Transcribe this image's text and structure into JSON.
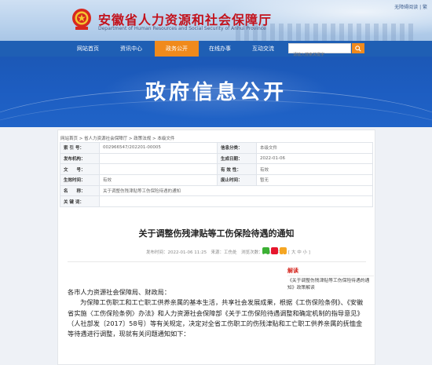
{
  "header": {
    "site_name": "安徽省人力资源和社会保障厅",
    "site_name_en": "Department of Human Resources and Social Security of Anhui Province",
    "top_links": "无障碍阅读 | 繁"
  },
  "nav": {
    "items": [
      "网站首页",
      "资讯中心",
      "政务公开",
      "在线办事",
      "互动交流"
    ],
    "active": "政务公开",
    "search_placeholder": "请输入搜索关键字"
  },
  "banner": {
    "title": "政府信息公开"
  },
  "breadcrumb": "网站首页 > 省人力资源社会保障厅 > 政策法规 > 本级文件",
  "meta": {
    "index_label": "索 引 号：",
    "index_value": "002966547/202201-00005",
    "category_label": "信息分类：",
    "category_value": "本级文件",
    "issuer_label": "发布机构：",
    "issuer_value": "",
    "date_label": "生成日期：",
    "date_value": "2022-01-06",
    "docno_label": "文　　号：",
    "docno_value": "",
    "validity_label": "有 效 性：",
    "validity_value": "有效",
    "effective_label": "生效时间：",
    "effective_value": "有效",
    "abolish_label": "废止时间：",
    "abolish_value": "暂无",
    "name_label": "名　　称：",
    "name_value": "关于调整伤残津贴等工伤保险待遇的通知",
    "keyword_label": "关 键 词：",
    "keyword_value": ""
  },
  "document": {
    "title": "关于调整伤残津贴等工伤保险待遇的通知",
    "info": "发布时间：2022-01-06 11:25　来源：工伤处　浏览次数：171　字体：[ 大 中 小 ]",
    "salutation": "各市人力资源社会保障局、财政局：",
    "paragraph": "为保障工伤职工和工亡职工供养亲属的基本生活，共享社会发展成果，根据《工伤保险条例》、《安徽省实施〈工伤保险条例〉办法》和人力资源社会保障部《关于工伤保险待遇调整和确定机制的指导意见》（人社部发〔2017〕58号）等有关规定，决定对全省工伤职工的伤残津贴和工亡职工供养亲属的抚恤金等待遇进行调整，现就有关问题通知如下："
  },
  "side": {
    "title": "解读",
    "item": "《关于调整伤残津贴等工伤保险待遇的通知》政策解读"
  },
  "colors": {
    "nav_bg": "#1f5fb4",
    "nav_active": "#f08a1c",
    "brand_red": "#c3121c",
    "banner_bg": "#1d5dc1"
  },
  "icons": [
    "emblem-icon",
    "search-icon",
    "wechat-icon",
    "weibo-icon",
    "qzone-icon"
  ]
}
